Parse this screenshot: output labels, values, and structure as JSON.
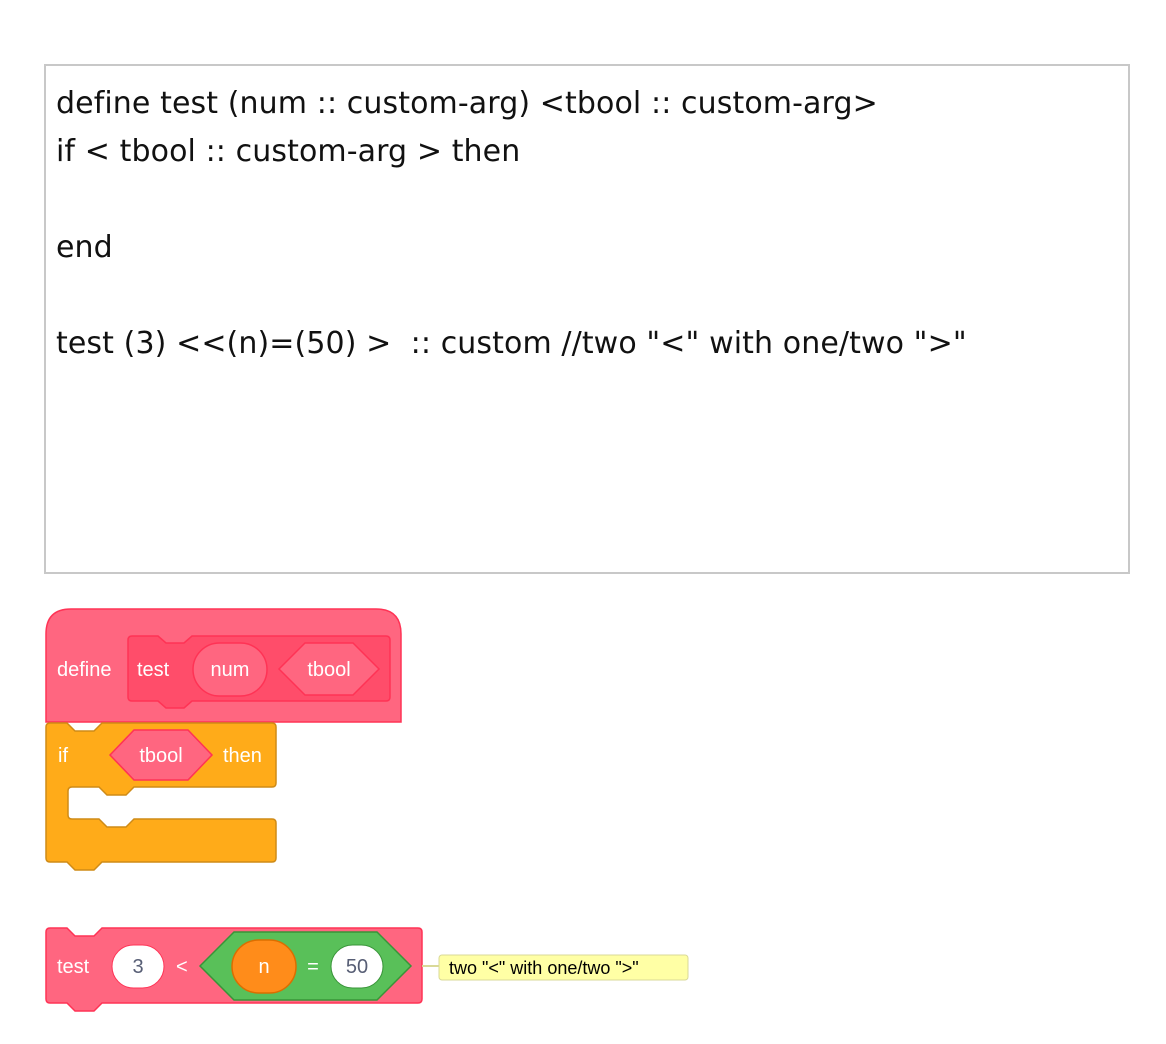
{
  "editor": {
    "lines": [
      "define test (num :: custom-arg) <tbool :: custom-arg>",
      "if < tbool :: custom-arg > then",
      "",
      "end",
      "",
      "test (3) <<(n)=(50) >  :: custom //two \"<\" with one/two \">\""
    ]
  },
  "define_block": {
    "keyword": "define",
    "name": "test",
    "arg_num": "num",
    "arg_bool": "tbool"
  },
  "if_block": {
    "keyword_if": "if",
    "condition": "tbool",
    "keyword_then": "then"
  },
  "call_block": {
    "name": "test",
    "arg_value": "3",
    "less_than": "<",
    "var": "n",
    "equals": "=",
    "compare_value": "50",
    "comment": "two \"<\" with one/two \">\""
  },
  "colors": {
    "custom": "#ff6680",
    "custom_dark": "#ff4d6a",
    "custom_border": "#ff3355",
    "control": "#ffab19",
    "control_border": "#cf8b17",
    "operators": "#59c059",
    "operators_border": "#389438",
    "variables": "#ff8c1a",
    "comment_bg": "#ffffa5",
    "comment_border": "#d9d998"
  }
}
